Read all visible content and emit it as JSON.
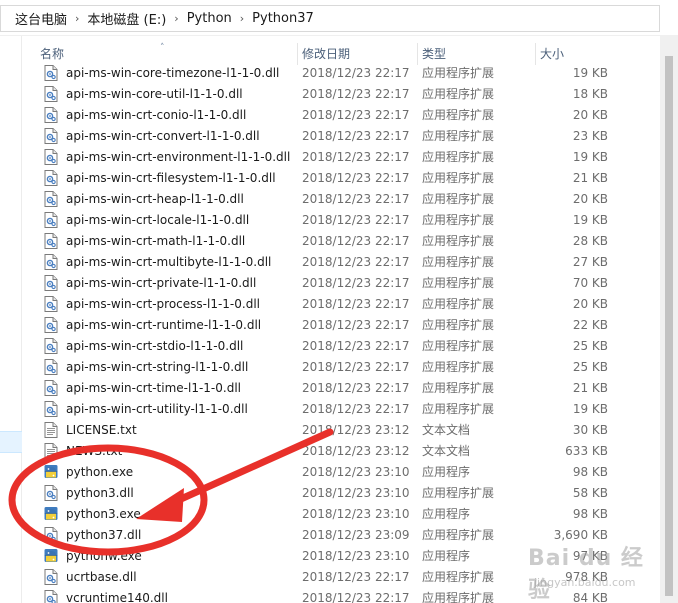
{
  "breadcrumb": {
    "items": [
      "这台电脑",
      "本地磁盘 (E:)",
      "Python",
      "Python37"
    ]
  },
  "columns": {
    "name": "名称",
    "date": "修改日期",
    "type": "类型",
    "size": "大小"
  },
  "files": [
    {
      "name": "api-ms-win-core-timezone-l1-1-0.dll",
      "date": "2018/12/23 22:17",
      "type": "应用程序扩展",
      "size": "19 KB",
      "icon": "dll-file-icon"
    },
    {
      "name": "api-ms-win-core-util-l1-1-0.dll",
      "date": "2018/12/23 22:17",
      "type": "应用程序扩展",
      "size": "18 KB",
      "icon": "dll-file-icon"
    },
    {
      "name": "api-ms-win-crt-conio-l1-1-0.dll",
      "date": "2018/12/23 22:17",
      "type": "应用程序扩展",
      "size": "20 KB",
      "icon": "dll-file-icon"
    },
    {
      "name": "api-ms-win-crt-convert-l1-1-0.dll",
      "date": "2018/12/23 22:17",
      "type": "应用程序扩展",
      "size": "23 KB",
      "icon": "dll-file-icon"
    },
    {
      "name": "api-ms-win-crt-environment-l1-1-0.dll",
      "date": "2018/12/23 22:17",
      "type": "应用程序扩展",
      "size": "19 KB",
      "icon": "dll-file-icon"
    },
    {
      "name": "api-ms-win-crt-filesystem-l1-1-0.dll",
      "date": "2018/12/23 22:17",
      "type": "应用程序扩展",
      "size": "21 KB",
      "icon": "dll-file-icon"
    },
    {
      "name": "api-ms-win-crt-heap-l1-1-0.dll",
      "date": "2018/12/23 22:17",
      "type": "应用程序扩展",
      "size": "20 KB",
      "icon": "dll-file-icon"
    },
    {
      "name": "api-ms-win-crt-locale-l1-1-0.dll",
      "date": "2018/12/23 22:17",
      "type": "应用程序扩展",
      "size": "19 KB",
      "icon": "dll-file-icon"
    },
    {
      "name": "api-ms-win-crt-math-l1-1-0.dll",
      "date": "2018/12/23 22:17",
      "type": "应用程序扩展",
      "size": "28 KB",
      "icon": "dll-file-icon"
    },
    {
      "name": "api-ms-win-crt-multibyte-l1-1-0.dll",
      "date": "2018/12/23 22:17",
      "type": "应用程序扩展",
      "size": "27 KB",
      "icon": "dll-file-icon"
    },
    {
      "name": "api-ms-win-crt-private-l1-1-0.dll",
      "date": "2018/12/23 22:17",
      "type": "应用程序扩展",
      "size": "70 KB",
      "icon": "dll-file-icon"
    },
    {
      "name": "api-ms-win-crt-process-l1-1-0.dll",
      "date": "2018/12/23 22:17",
      "type": "应用程序扩展",
      "size": "20 KB",
      "icon": "dll-file-icon"
    },
    {
      "name": "api-ms-win-crt-runtime-l1-1-0.dll",
      "date": "2018/12/23 22:17",
      "type": "应用程序扩展",
      "size": "22 KB",
      "icon": "dll-file-icon"
    },
    {
      "name": "api-ms-win-crt-stdio-l1-1-0.dll",
      "date": "2018/12/23 22:17",
      "type": "应用程序扩展",
      "size": "25 KB",
      "icon": "dll-file-icon"
    },
    {
      "name": "api-ms-win-crt-string-l1-1-0.dll",
      "date": "2018/12/23 22:17",
      "type": "应用程序扩展",
      "size": "25 KB",
      "icon": "dll-file-icon"
    },
    {
      "name": "api-ms-win-crt-time-l1-1-0.dll",
      "date": "2018/12/23 22:17",
      "type": "应用程序扩展",
      "size": "21 KB",
      "icon": "dll-file-icon"
    },
    {
      "name": "api-ms-win-crt-utility-l1-1-0.dll",
      "date": "2018/12/23 22:17",
      "type": "应用程序扩展",
      "size": "19 KB",
      "icon": "dll-file-icon"
    },
    {
      "name": "LICENSE.txt",
      "date": "2018/12/23 23:12",
      "type": "文本文档",
      "size": "30 KB",
      "icon": "text-file-icon"
    },
    {
      "name": "NEWS.txt",
      "date": "2018/12/23 23:12",
      "type": "文本文档",
      "size": "633 KB",
      "icon": "text-file-icon"
    },
    {
      "name": "python.exe",
      "date": "2018/12/23 23:10",
      "type": "应用程序",
      "size": "98 KB",
      "icon": "python-exe-icon"
    },
    {
      "name": "python3.dll",
      "date": "2018/12/23 23:10",
      "type": "应用程序扩展",
      "size": "58 KB",
      "icon": "dll-file-icon"
    },
    {
      "name": "python3.exe",
      "date": "2018/12/23 23:10",
      "type": "应用程序",
      "size": "98 KB",
      "icon": "python-exe-icon"
    },
    {
      "name": "python37.dll",
      "date": "2018/12/23 23:09",
      "type": "应用程序扩展",
      "size": "3,690 KB",
      "icon": "dll-file-icon"
    },
    {
      "name": "pythonw.exe",
      "date": "2018/12/23 23:10",
      "type": "应用程序",
      "size": "97 KB",
      "icon": "python-exe-icon"
    },
    {
      "name": "ucrtbase.dll",
      "date": "2018/12/23 22:17",
      "type": "应用程序扩展",
      "size": "978 KB",
      "icon": "dll-file-icon"
    },
    {
      "name": "vcruntime140.dll",
      "date": "2018/12/23 22:17",
      "type": "应用程序扩展",
      "size": "84 KB",
      "icon": "dll-file-icon"
    }
  ],
  "annotation": {
    "color": "#e8302a"
  },
  "watermark": {
    "brand": "Bai du 经验",
    "url": "jingyan.baidu.com"
  }
}
